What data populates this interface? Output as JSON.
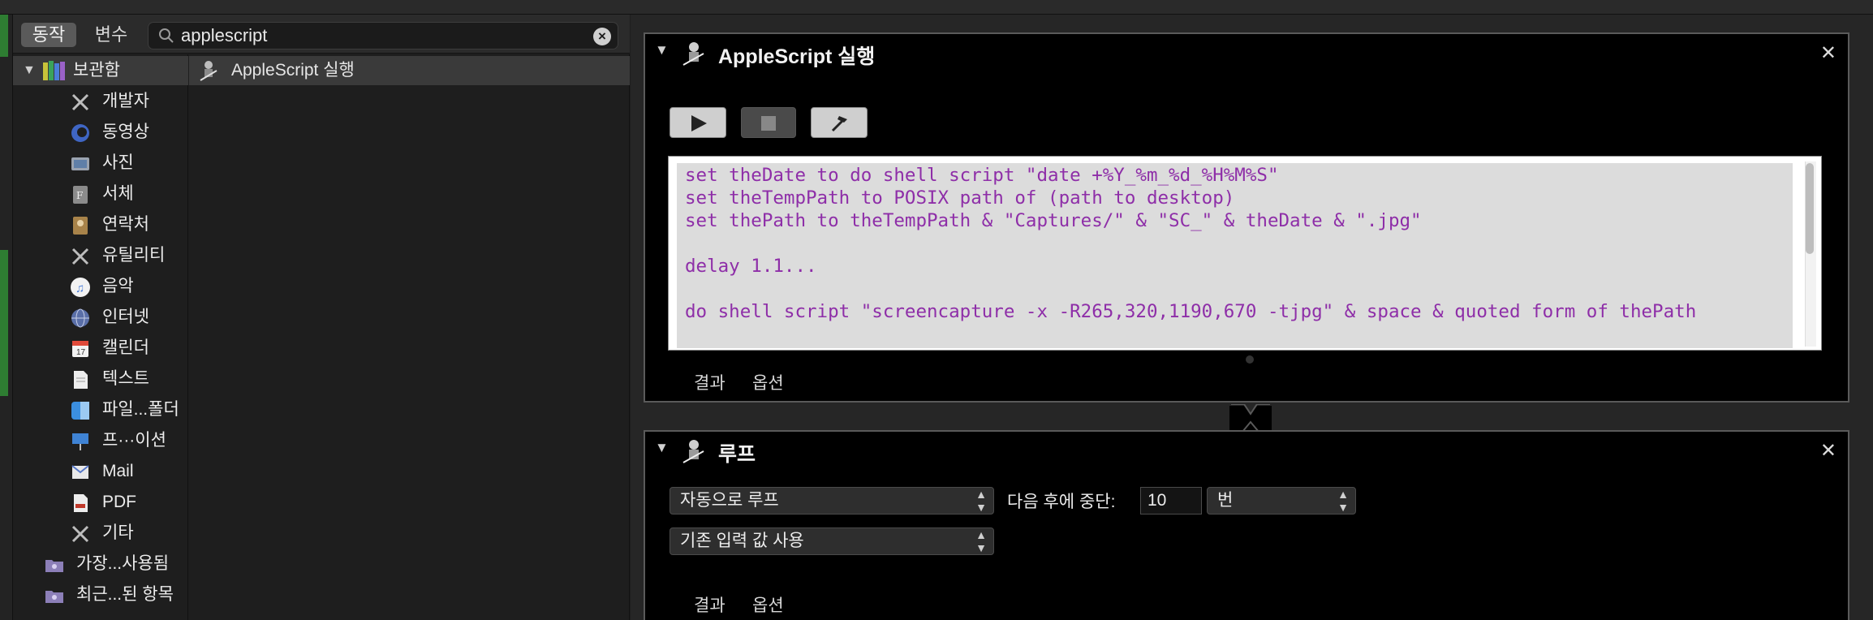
{
  "library_toolbar": {
    "actions_tab": "동작",
    "variables_tab": "변수",
    "search_value": "applescript"
  },
  "library": {
    "root": "보관함",
    "items": [
      {
        "label": "개발자",
        "icon": "tools-icon"
      },
      {
        "label": "동영상",
        "icon": "video-icon"
      },
      {
        "label": "사진",
        "icon": "photo-icon"
      },
      {
        "label": "서체",
        "icon": "font-icon"
      },
      {
        "label": "연락처",
        "icon": "contacts-icon"
      },
      {
        "label": "유틸리티",
        "icon": "tools-icon"
      },
      {
        "label": "음악",
        "icon": "music-icon"
      },
      {
        "label": "인터넷",
        "icon": "globe-icon"
      },
      {
        "label": "캘린더",
        "icon": "calendar-icon"
      },
      {
        "label": "텍스트",
        "icon": "text-icon"
      },
      {
        "label": "파일...폴더",
        "icon": "finder-icon"
      },
      {
        "label": "프···이션",
        "icon": "presentation-icon"
      },
      {
        "label": "Mail",
        "icon": "mail-icon"
      },
      {
        "label": "PDF",
        "icon": "pdf-icon"
      },
      {
        "label": "기타",
        "icon": "tools-icon"
      }
    ],
    "smart_folders": [
      {
        "label": "가장...사용됨",
        "icon": "smart-folder-icon"
      },
      {
        "label": "최근...된 항목",
        "icon": "smart-folder-icon"
      }
    ]
  },
  "actions_list": {
    "selected": "AppleScript 실행"
  },
  "panel_applescript": {
    "title": "AppleScript 실행",
    "code": [
      "set theDate to do shell script \"date +%Y_%m_%d_%H%M%S\"",
      "set theTempPath to POSIX path of (path to desktop)",
      "set thePath to theTempPath & \"Captures/\" & \"SC_\" & theDate & \".jpg\"",
      "",
      "delay 1.1...",
      "",
      "do shell script \"screencapture -x -R265,320,1190,670 -tjpg\" & space & quoted form of thePath"
    ],
    "tab_results": "결과",
    "tab_options": "옵션"
  },
  "panel_loop": {
    "title": "루프",
    "loop_mode": "자동으로 루프",
    "stop_after_label": "다음 후에 중단:",
    "stop_after_value": "10",
    "unit": "번",
    "input_mode": "기존 입력 값 사용",
    "tab_results": "결과",
    "tab_options": "옵션"
  },
  "colors": {
    "code_text": "#8e2ea8",
    "panel_bg": "#000000",
    "selection": "#3a3a3a"
  }
}
